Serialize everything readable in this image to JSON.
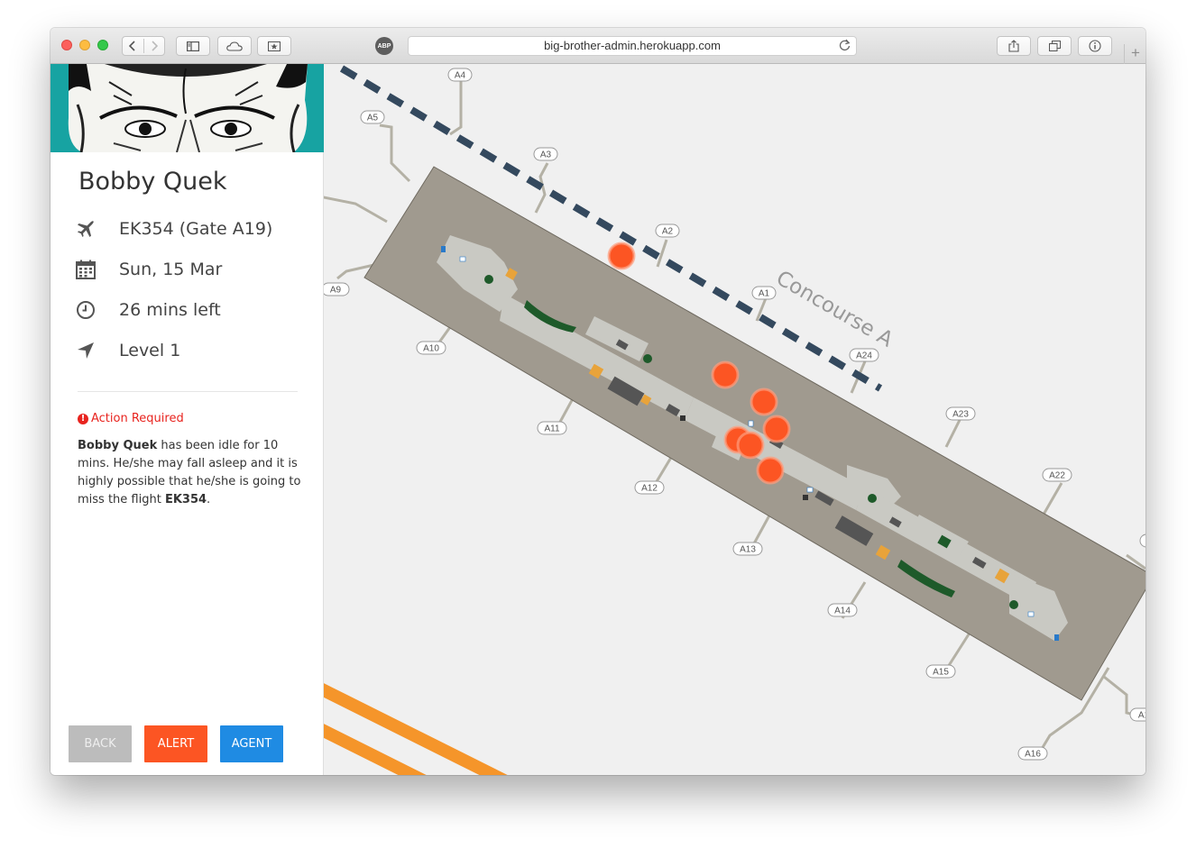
{
  "browser": {
    "url": "big-brother-admin.herokuapp.com",
    "abp_label": "ABP",
    "new_tab_label": "+"
  },
  "passenger": {
    "name": "Bobby Quek",
    "flight_gate": "EK354 (Gate A19)",
    "date": "Sun, 15 Mar",
    "time_left": "26 mins left",
    "level": "Level 1"
  },
  "alert": {
    "title": "Action Required",
    "body_name": "Bobby Quek",
    "body_text_1": " has been idle for 10 mins. He/she may fall asleep and it is highly possible that he/she is going to miss the flight ",
    "body_flight": "EK354",
    "body_text_2": "."
  },
  "buttons": {
    "back": "BACK",
    "alert": "ALERT",
    "agent": "AGENT"
  },
  "map": {
    "concourse_label": "Concourse A",
    "gates": {
      "A1": "A1",
      "A2": "A2",
      "A3": "A3",
      "A4": "A4",
      "A5": "A5",
      "A9": "A9",
      "A10": "A10",
      "A11": "A11",
      "A12": "A12",
      "A13": "A13",
      "A14": "A14",
      "A15": "A15",
      "A16": "A16",
      "A22": "A22",
      "A23": "A23",
      "A24": "A24",
      "A17": "A1"
    },
    "colors": {
      "terminal": "#a09a8f",
      "interior": "#c9c9c3",
      "passenger_marker": "#fc5523",
      "dashed_route": "#34495e",
      "orange_road": "#f5952a",
      "sidebar_banner": "#17a3a2"
    }
  }
}
